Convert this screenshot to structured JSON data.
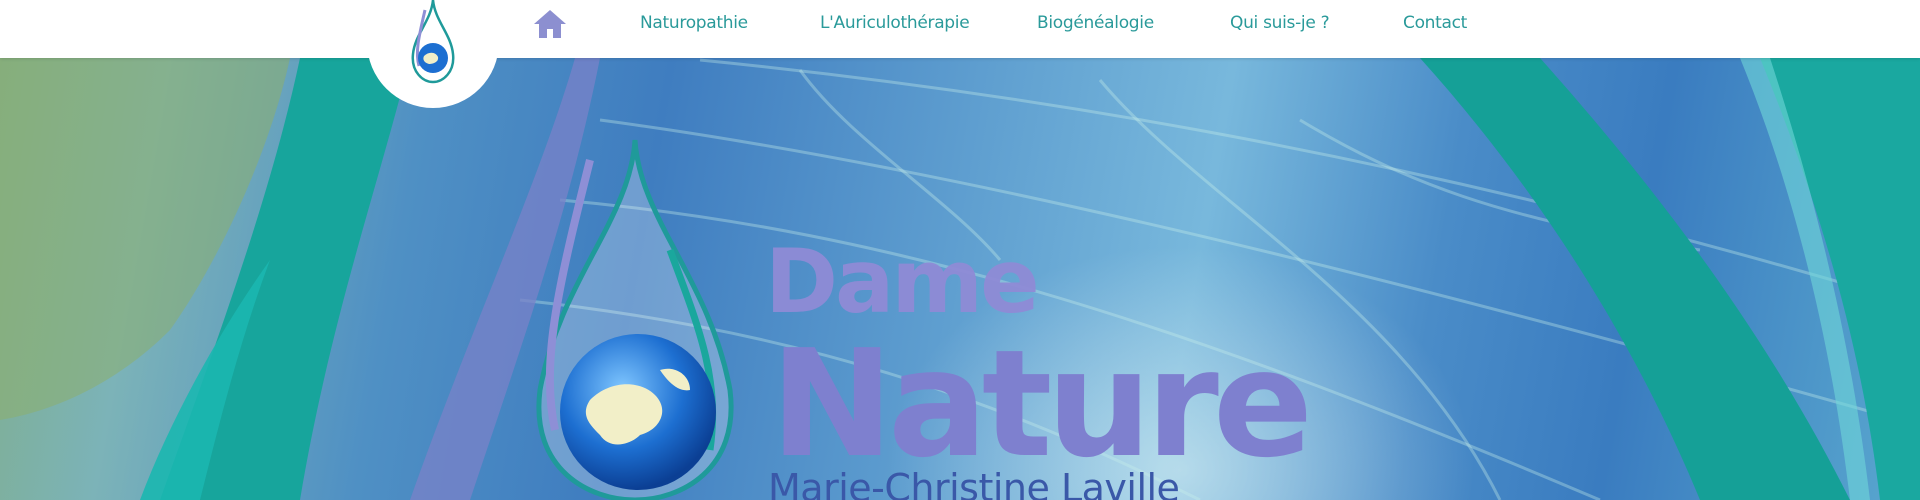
{
  "site": {
    "nav": {
      "home_icon": "home-icon",
      "items": [
        {
          "label": "Naturopathie"
        },
        {
          "label": "L'Auriculothérapie"
        },
        {
          "label": "Biogénéalogie"
        },
        {
          "label": "Qui suis-je ?"
        },
        {
          "label": "Contact"
        }
      ]
    },
    "logo_icon": "water-drop-globe-icon"
  },
  "hero": {
    "brand_line1": "Dame",
    "brand_line2": "Nature",
    "owner_name": "Marie-Christine Laville",
    "emblem_icon": "water-drop-globe-icon"
  },
  "colors": {
    "nav_text": "#2a9a9a",
    "brand_purple": "#8f8bd6",
    "owner_blue": "#3a58a8",
    "teal_band": "#16a39a"
  }
}
